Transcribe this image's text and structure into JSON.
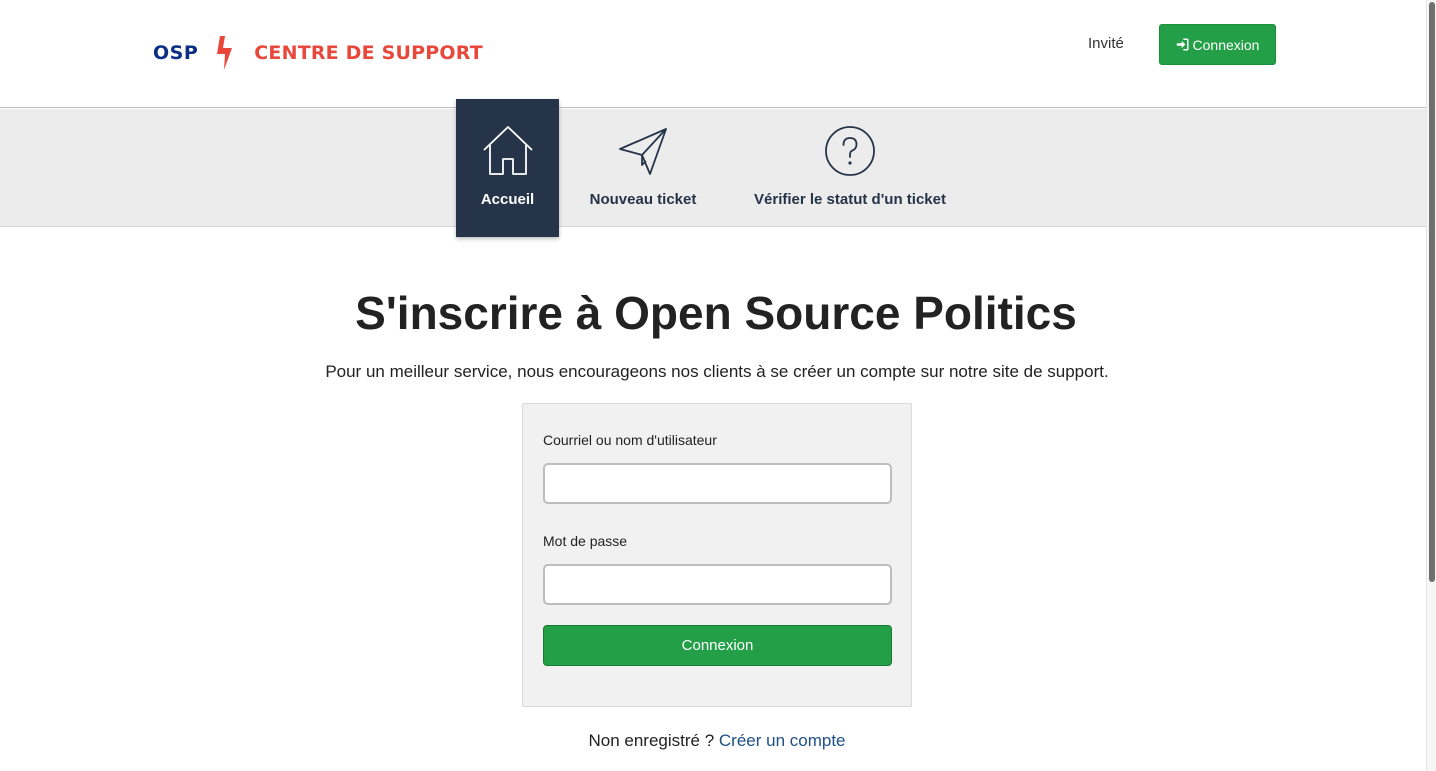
{
  "header": {
    "logo_left": "OSP",
    "logo_right": "CENTRE DE SUPPORT",
    "logo_bolt_icon": "lightning-bolt-icon",
    "guest_label": "Invité",
    "login_button": "Connexion",
    "login_icon": "sign-in-icon"
  },
  "nav": {
    "items": [
      {
        "label": "Accueil",
        "icon": "home-icon",
        "active": true
      },
      {
        "label": "Nouveau ticket",
        "icon": "paper-plane-icon",
        "active": false
      },
      {
        "label": "Vérifier le statut d'un ticket",
        "icon": "question-circle-icon",
        "active": false
      }
    ]
  },
  "main": {
    "title": "S'inscrire à Open Source Politics",
    "subtitle": "Pour un meilleur service, nous encourageons nos clients à se créer un compte sur notre site de support.",
    "form": {
      "username_label": "Courriel ou nom d'utilisateur",
      "username_value": "",
      "password_label": "Mot de passe",
      "password_value": "",
      "submit_label": "Connexion"
    },
    "register_prefix": "Non enregistré ?",
    "register_link": "Créer un compte"
  },
  "colors": {
    "brand_blue": "#0b2e86",
    "brand_red": "#e8483b",
    "success_green": "#23a047",
    "nav_dark": "#26344a"
  }
}
